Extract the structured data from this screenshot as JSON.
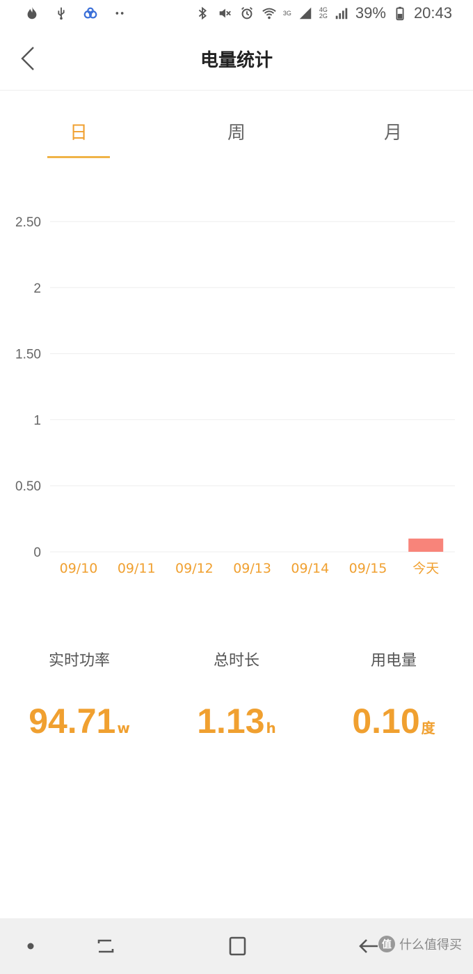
{
  "status_bar": {
    "battery": "39%",
    "time": "20:43",
    "net_a_top": "3G",
    "net_b_top": "4G",
    "net_b_bottom": "2G",
    "icons_left": [
      "flame-icon",
      "usb-icon",
      "baidu-icon",
      "more-dots-icon"
    ],
    "icons_right": [
      "bluetooth-icon",
      "mute-icon",
      "alarm-icon",
      "wifi-icon",
      "signal-icon",
      "battery-icon"
    ]
  },
  "header": {
    "title": "电量统计"
  },
  "tabs": [
    {
      "label": "日",
      "active": true
    },
    {
      "label": "周",
      "active": false
    },
    {
      "label": "月",
      "active": false
    }
  ],
  "chart_data": {
    "type": "bar",
    "categories": [
      "09/10",
      "09/11",
      "09/12",
      "09/13",
      "09/14",
      "09/15",
      "今天"
    ],
    "values": [
      0,
      0,
      0,
      0,
      0,
      0,
      0.1
    ],
    "y_ticks": [
      "2.50",
      "2",
      "1.50",
      "1",
      "0.50",
      "0"
    ],
    "y_tick_values": [
      2.5,
      2,
      1.5,
      1,
      0.5,
      0
    ],
    "ylim": [
      0,
      2.5
    ],
    "grid": true,
    "bar_color": "#f8847a",
    "tick_label_color": "#f0a030"
  },
  "stats": [
    {
      "label": "实时功率",
      "value": "94.71",
      "unit": "w"
    },
    {
      "label": "总时长",
      "value": "1.13",
      "unit": "h"
    },
    {
      "label": "用电量",
      "value": "0.10",
      "unit": "度"
    }
  ],
  "colors": {
    "accent": "#f0a030",
    "bar": "#f8847a"
  },
  "watermark": {
    "text": "什么值得买",
    "logo": "值"
  }
}
